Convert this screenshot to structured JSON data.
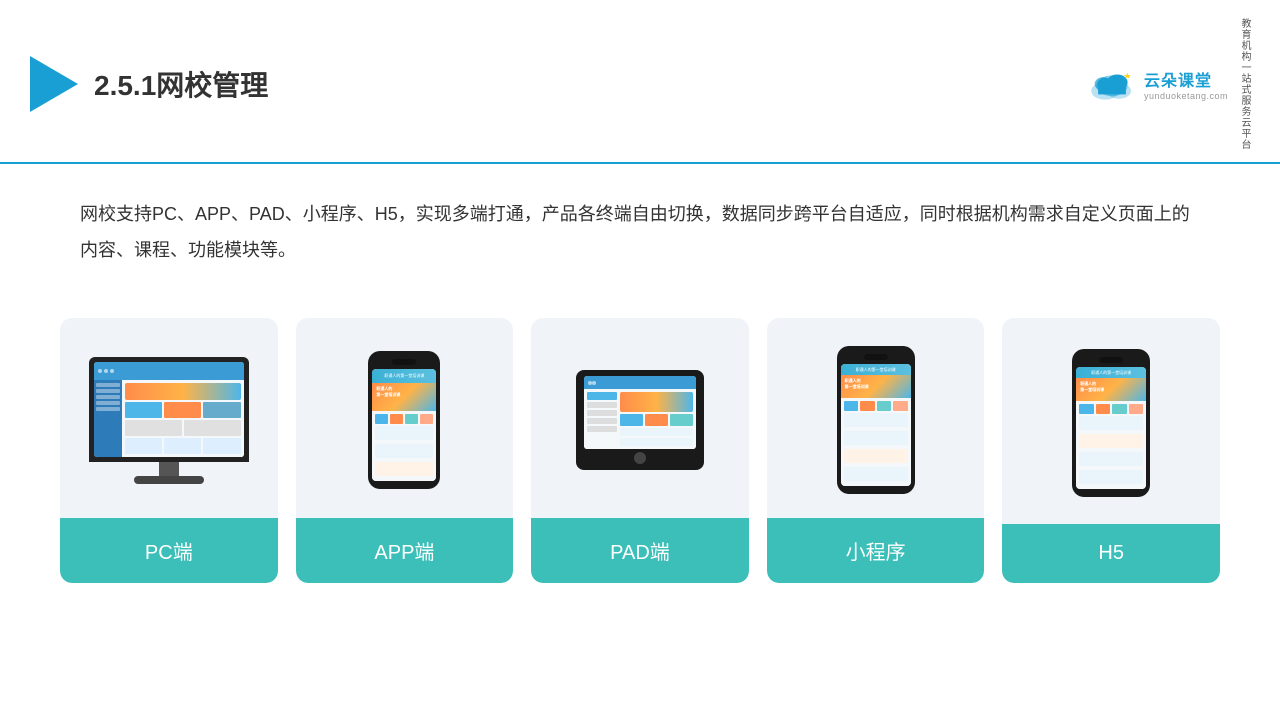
{
  "header": {
    "title": "2.5.1网校管理",
    "logo_name": "云朵课堂",
    "logo_url": "yunduoketang.com",
    "logo_slogan": "教育机构一站式服务云平台"
  },
  "description": {
    "text": "网校支持PC、APP、PAD、小程序、H5，实现多端打通，产品各终端自由切换，数据同步跨平台自适应，同时根据机构需求自定义页面上的内容、课程、功能模块等。"
  },
  "cards": [
    {
      "id": "pc",
      "label": "PC端"
    },
    {
      "id": "app",
      "label": "APP端"
    },
    {
      "id": "pad",
      "label": "PAD端"
    },
    {
      "id": "miniprogram",
      "label": "小程序"
    },
    {
      "id": "h5",
      "label": "H5"
    }
  ],
  "colors": {
    "teal": "#3bbfb8",
    "blue": "#1a9fd4",
    "card_bg": "#f0f4f8"
  }
}
